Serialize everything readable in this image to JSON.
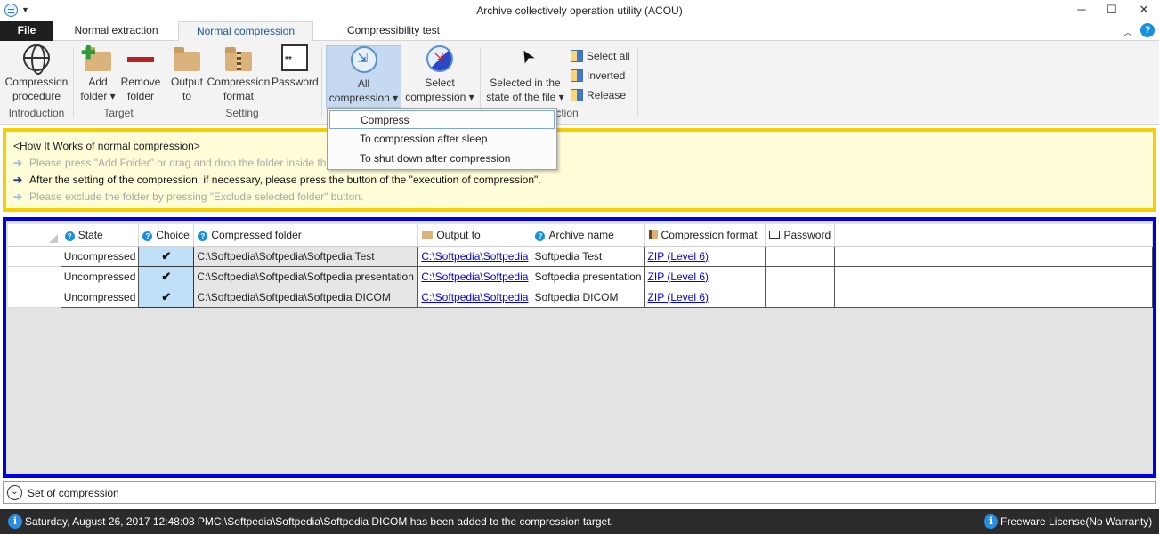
{
  "window": {
    "title": "Archive collectively operation utility (ACOU)",
    "icon": "app-icon",
    "buttons": {
      "minimize": "─",
      "maximize": "☐",
      "close": "✕"
    }
  },
  "tabs": {
    "file": "File",
    "items": [
      "Normal extraction",
      "Normal compression",
      "Compressibility test"
    ],
    "active": "Normal compression"
  },
  "ribbon": {
    "introduction": {
      "label1": "Compression",
      "label2": "procedure",
      "group": "Introduction"
    },
    "target": {
      "add1": "Add",
      "add2": "folder ▾",
      "remove1": "Remove",
      "remove2": "folder",
      "group": "Target"
    },
    "setting": {
      "output1": "Output",
      "output2": "to",
      "format1": "Compression",
      "format2": "format",
      "password": "Password",
      "group": "Setting"
    },
    "execution": {
      "all1": "All",
      "all2": "compression ▾",
      "select1": "Select",
      "select2": "compression ▾",
      "state1": "Selected in the",
      "state2": "state of the file ▾",
      "group_partial": "ction"
    },
    "selection": {
      "select_all": "Select all",
      "inverted": "Inverted",
      "release": "Release"
    }
  },
  "dropdown": {
    "items": [
      "Compress",
      "To compression after sleep",
      "To shut down after compression"
    ],
    "highlighted": "Compress"
  },
  "help": {
    "title": "<How It Works of normal compression>",
    "lines": [
      {
        "text": "Please press \"Add Folder\" or drag and drop the folder inside th",
        "state": "dim"
      },
      {
        "text": "After the setting of the compression, if necessary, please press the button of the \"execution of compression\".",
        "state": "active"
      },
      {
        "text": "Please exclude the folder by pressing \"Exclude selected folder\" button.",
        "state": "dim"
      }
    ]
  },
  "grid": {
    "columns": [
      "State",
      "Choice",
      "Compressed folder",
      "Output to",
      "Archive name",
      "Compression format",
      "Password"
    ],
    "rows": [
      {
        "state": "Uncompressed",
        "choice": "✔",
        "folder": "C:\\Softpedia\\Softpedia\\Softpedia Test",
        "output": "C:\\Softpedia\\Softpedia",
        "archive": "Softpedia Test",
        "format": "ZIP (Level 6)",
        "password": ""
      },
      {
        "state": "Uncompressed",
        "choice": "✔",
        "folder": "C:\\Softpedia\\Softpedia\\Softpedia presentation",
        "output": "C:\\Softpedia\\Softpedia",
        "archive": "Softpedia presentation",
        "format": "ZIP (Level 6)",
        "password": ""
      },
      {
        "state": "Uncompressed",
        "choice": "✔",
        "folder": "C:\\Softpedia\\Softpedia\\Softpedia DICOM",
        "output": "C:\\Softpedia\\Softpedia",
        "archive": "Softpedia DICOM",
        "format": "ZIP (Level 6)",
        "password": ""
      }
    ]
  },
  "settings_bar": {
    "label": "Set of compression",
    "icon": "chevron-down-icon"
  },
  "status": {
    "message": "Saturday, August 26, 2017 12:48:08 PMC:\\Softpedia\\Softpedia\\Softpedia DICOM has been added to the compression target.",
    "license": "Freeware License(No Warranty)"
  },
  "colors": {
    "help_border": "#f5cf00",
    "help_bg": "#fffdd8",
    "grid_border": "#0000e8",
    "status_bg": "#2b2b2b",
    "file_tab_bg": "#1f1f1f",
    "accent": "#1a8fe0"
  }
}
